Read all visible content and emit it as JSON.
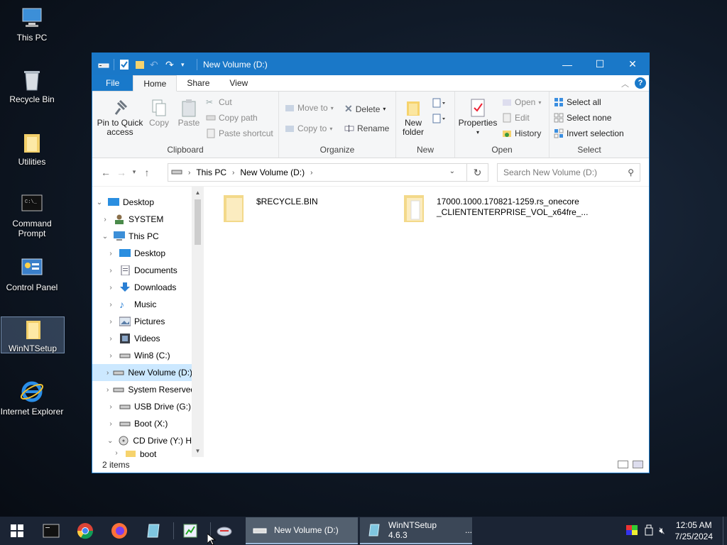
{
  "desktop": {
    "icons": [
      {
        "label": "This PC"
      },
      {
        "label": "Recycle Bin"
      },
      {
        "label": "Utilities"
      },
      {
        "label": "Command Prompt"
      },
      {
        "label": "Control Panel"
      },
      {
        "label": "WinNTSetup"
      },
      {
        "label": "Internet Explorer"
      }
    ]
  },
  "window": {
    "title": "New Volume (D:)",
    "controls": {
      "minimize": "—",
      "maximize": "☐",
      "close": "✕"
    }
  },
  "ribbon": {
    "tabs": [
      {
        "label": "File"
      },
      {
        "label": "Home"
      },
      {
        "label": "Share"
      },
      {
        "label": "View"
      }
    ],
    "help": "?",
    "clipboard": {
      "label": "Clipboard",
      "pin": "Pin to Quick access",
      "copy": "Copy",
      "paste": "Paste",
      "cut": "Cut",
      "copy_path": "Copy path",
      "paste_shortcut": "Paste shortcut"
    },
    "organize": {
      "label": "Organize",
      "move_to": "Move to",
      "copy_to": "Copy to",
      "delete": "Delete",
      "rename": "Rename"
    },
    "new": {
      "label": "New",
      "new_folder": "New folder"
    },
    "open": {
      "label": "Open",
      "properties": "Properties",
      "open": "Open",
      "edit": "Edit",
      "history": "History"
    },
    "select": {
      "label": "Select",
      "select_all": "Select all",
      "select_none": "Select none",
      "invert": "Invert selection"
    }
  },
  "address": {
    "crumbs": [
      "This PC",
      "New Volume (D:)"
    ],
    "search_placeholder": "Search New Volume (D:)"
  },
  "nav_tree": [
    {
      "label": "Desktop"
    },
    {
      "label": "SYSTEM"
    },
    {
      "label": "This PC"
    },
    {
      "label": "Desktop"
    },
    {
      "label": "Documents"
    },
    {
      "label": "Downloads"
    },
    {
      "label": "Music"
    },
    {
      "label": "Pictures"
    },
    {
      "label": "Videos"
    },
    {
      "label": "Win8 (C:)"
    },
    {
      "label": "New Volume (D:)"
    },
    {
      "label": "System Reserved"
    },
    {
      "label": "USB Drive (G:)"
    },
    {
      "label": "Boot (X:)"
    },
    {
      "label": "CD Drive (Y:) H"
    },
    {
      "label": "boot"
    }
  ],
  "files": [
    {
      "name_line1": "$RECYCLE.BIN",
      "name_line2": ""
    },
    {
      "name_line1": "17000.1000.170821-1259.rs_onecore",
      "name_line2": "_CLIENTENTERPRISE_VOL_x64fre_..."
    }
  ],
  "status": {
    "items": "2 items"
  },
  "taskbar": {
    "apps": [
      {
        "label": "New Volume (D:)"
      },
      {
        "label": "WinNTSetup 4.6.3"
      }
    ],
    "app2_suffix": "...",
    "clock_time": "12:05 AM",
    "clock_date": "7/25/2024"
  },
  "colors": {
    "accent": "#1a78c8",
    "selection": "#cce8ff",
    "taskbar": "#1b2434"
  }
}
